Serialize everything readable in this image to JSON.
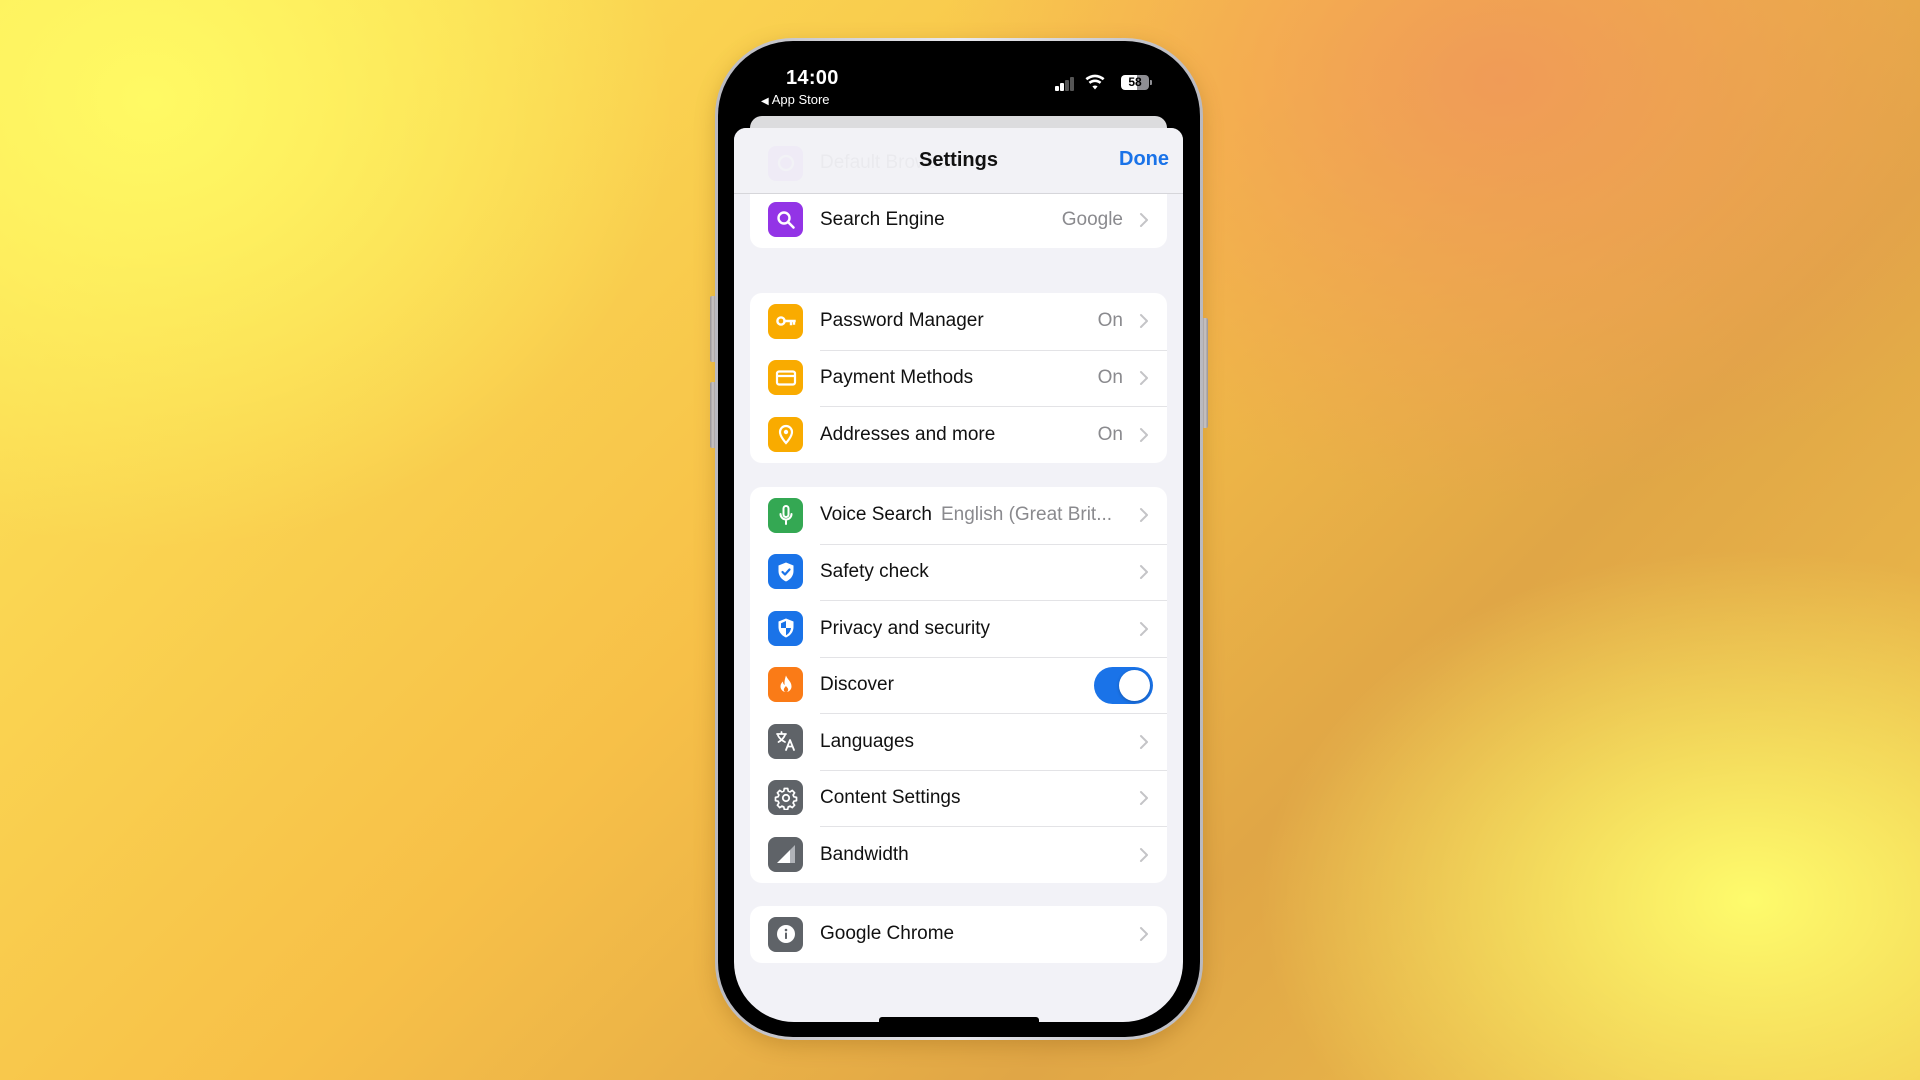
{
  "status_bar": {
    "time": "14:00",
    "back_app": "App Store",
    "battery": "58",
    "signal_bars_active": 2,
    "signal_bars_total": 4
  },
  "nav": {
    "title": "Settings",
    "done_label": "Done"
  },
  "colors": {
    "accent": "#1a73e8",
    "purple": "#9334e6",
    "yellow": "#f9ab00",
    "green": "#34a853",
    "blue": "#1a73e8",
    "orange": "#fa7b17",
    "gray": "#5f6368"
  },
  "groups": [
    {
      "rows": [
        {
          "label": "Default Browser",
          "icon": "default-browser-icon",
          "partial": true
        },
        {
          "label": "Search Engine",
          "value": "Google",
          "icon": "search-icon"
        }
      ]
    },
    {
      "rows": [
        {
          "label": "Password Manager",
          "value": "On",
          "icon": "key-icon"
        },
        {
          "label": "Payment Methods",
          "value": "On",
          "icon": "credit-card-icon"
        },
        {
          "label": "Addresses and more",
          "value": "On",
          "icon": "location-pin-icon"
        }
      ]
    },
    {
      "rows": [
        {
          "label": "Voice Search",
          "value": "English (Great Brit...",
          "icon": "microphone-icon"
        },
        {
          "label": "Safety check",
          "icon": "shield-check-icon"
        },
        {
          "label": "Privacy and security",
          "icon": "shield-icon"
        },
        {
          "label": "Discover",
          "icon": "flame-icon",
          "toggle": true,
          "toggle_on": true
        },
        {
          "label": "Languages",
          "icon": "translate-icon"
        },
        {
          "label": "Content Settings",
          "icon": "gear-icon"
        },
        {
          "label": "Bandwidth",
          "icon": "signal-bandwidth-icon"
        }
      ]
    },
    {
      "rows": [
        {
          "label": "Google Chrome",
          "icon": "info-icon"
        }
      ]
    }
  ]
}
